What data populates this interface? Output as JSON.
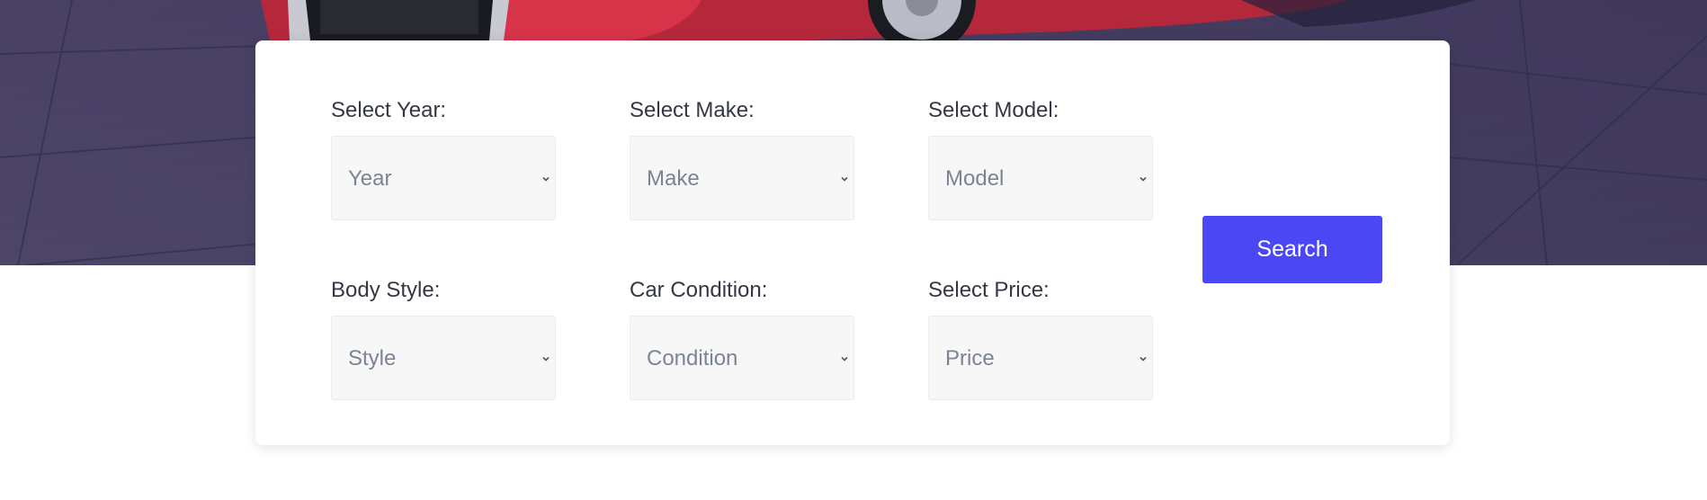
{
  "search_form": {
    "fields": [
      {
        "label": "Select Year:",
        "value": "Year"
      },
      {
        "label": "Select Make:",
        "value": "Make"
      },
      {
        "label": "Select Model:",
        "value": "Model"
      },
      {
        "label": "Body Style:",
        "value": "Style"
      },
      {
        "label": "Car Condition:",
        "value": "Condition"
      },
      {
        "label": "Select Price:",
        "value": "Price"
      }
    ],
    "search_label": "Search"
  },
  "colors": {
    "accent": "#4b47f5",
    "select_background": "#f7f7f7",
    "placeholder_text": "#7b8494"
  },
  "icons": {
    "select_arrow": "chevron-down-icon",
    "hero": "car-photo"
  }
}
